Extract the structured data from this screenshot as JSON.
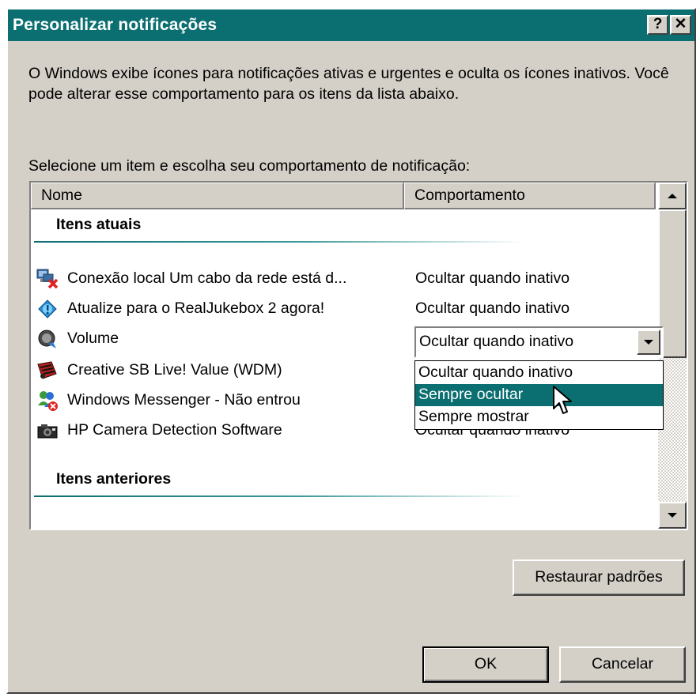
{
  "window": {
    "title": "Personalizar notificações",
    "help_label": "?",
    "close_label": "✕"
  },
  "description": "O Windows exibe ícones para notificações ativas e urgentes e oculta os ícones inativos. Você pode alterar esse comportamento para os itens da lista abaixo.",
  "prompt": "Selecione um item e escolha seu comportamento de notificação:",
  "list": {
    "columns": [
      "Nome",
      "Comportamento"
    ],
    "groups": {
      "current": "Itens atuais",
      "previous": "Itens anteriores"
    },
    "rows": [
      {
        "name": "Conexão local Um cabo da rede está d...",
        "behavior": "Ocultar quando inativo",
        "icon": "network-disconnected-icon"
      },
      {
        "name": "Atualize para o RealJukebox 2 agora!",
        "behavior": "Ocultar quando inativo",
        "icon": "realjukebox-icon"
      },
      {
        "name": "Volume",
        "behavior": "Ocultar quando inativo",
        "icon": "volume-icon"
      },
      {
        "name": "Creative SB Live! Value (WDM)",
        "behavior": "",
        "icon": "creative-soundcard-icon"
      },
      {
        "name": "Windows Messenger - Não entrou",
        "behavior": "",
        "icon": "messenger-icon"
      },
      {
        "name": "HP Camera Detection Software",
        "behavior": "Ocultar quando inativo",
        "icon": "camera-icon"
      }
    ],
    "combo_value": "Ocultar quando inativo",
    "dropdown_options": [
      "Ocultar quando inativo",
      "Sempre ocultar",
      "Sempre mostrar"
    ],
    "dropdown_selected_index": 1
  },
  "buttons": {
    "restore": "Restaurar padrões",
    "ok": "OK",
    "cancel": "Cancelar"
  },
  "colors": {
    "titlebar": "#0b6e70",
    "selection": "#0b6e70",
    "face": "#d4d0c8"
  }
}
